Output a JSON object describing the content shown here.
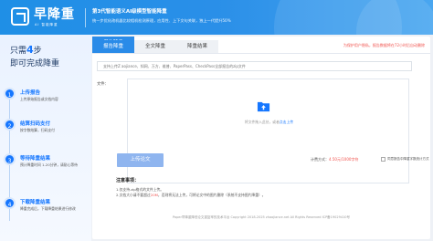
{
  "header": {
    "logo_name": "早降重",
    "logo_sub": "AI 智能降重",
    "title": "第3代智能语义AI级模型智能降重",
    "description": "统一步优化改机器比较相机检测原理，应用性、上下文句关联，独上一代提升50%"
  },
  "sidebar": {
    "heading_prefix": "只需",
    "heading_number": "4",
    "heading_suffix": "步",
    "heading_line2": "即可完成降重",
    "steps": [
      {
        "num": "1",
        "title": "上传报告",
        "desc": "上传原始报告或文档内容"
      },
      {
        "num": "2",
        "title": "结算扫码支付",
        "desc": "按字数结算，扫码支付"
      },
      {
        "num": "3",
        "title": "等待降重结果",
        "desc": "预计降重时间 1-20分钟，请耐心等待"
      },
      {
        "num": "4",
        "title": "下载降重结果",
        "desc": "降重完成后，下载降重结果进行修改"
      }
    ]
  },
  "tabs": [
    {
      "label": "报告降重",
      "active": true
    },
    {
      "label": "全文降重",
      "active": false
    },
    {
      "label": "降重结果",
      "active": false
    }
  ],
  "notice": "为保护用户隐私，报告数据将在72小时后自动删除",
  "form": {
    "title_placeholder": "支持上传Z aojiance、知网、万方、维普、PaperPass、CheckPass全部报告的zip文件",
    "file_label": "文件：",
    "upload_hint_prefix": "将文件拖入此处，或者",
    "upload_hint_link": "点击上传",
    "upload_button": "上传论文",
    "price_label": "计费方式：",
    "price_value": "4.50元/1000字符",
    "checkbox_label": "同意报告中降重字数统计方式"
  },
  "notes": {
    "title": "注意事项：",
    "items": [
      {
        "text": "1.仅支持.zip格式的文件上传。",
        "highlight": ""
      },
      {
        "text": "2.文档大小请不要超过",
        "highlight": "20M",
        "tail": "，否则将无法上传，可将论文中的图片删除（系统不支持图片降重）。"
      }
    ]
  },
  "footer": "Paper早降重降低论文重复率的技术平台     Copyright 2018-2025 zhaojiance.net All Rights Reserved ICP备19029410号",
  "colors": {
    "primary": "#1677ff",
    "header_start": "#1f8fe6",
    "upload_button": "#8fb5ef",
    "notice": "#f0514c"
  }
}
